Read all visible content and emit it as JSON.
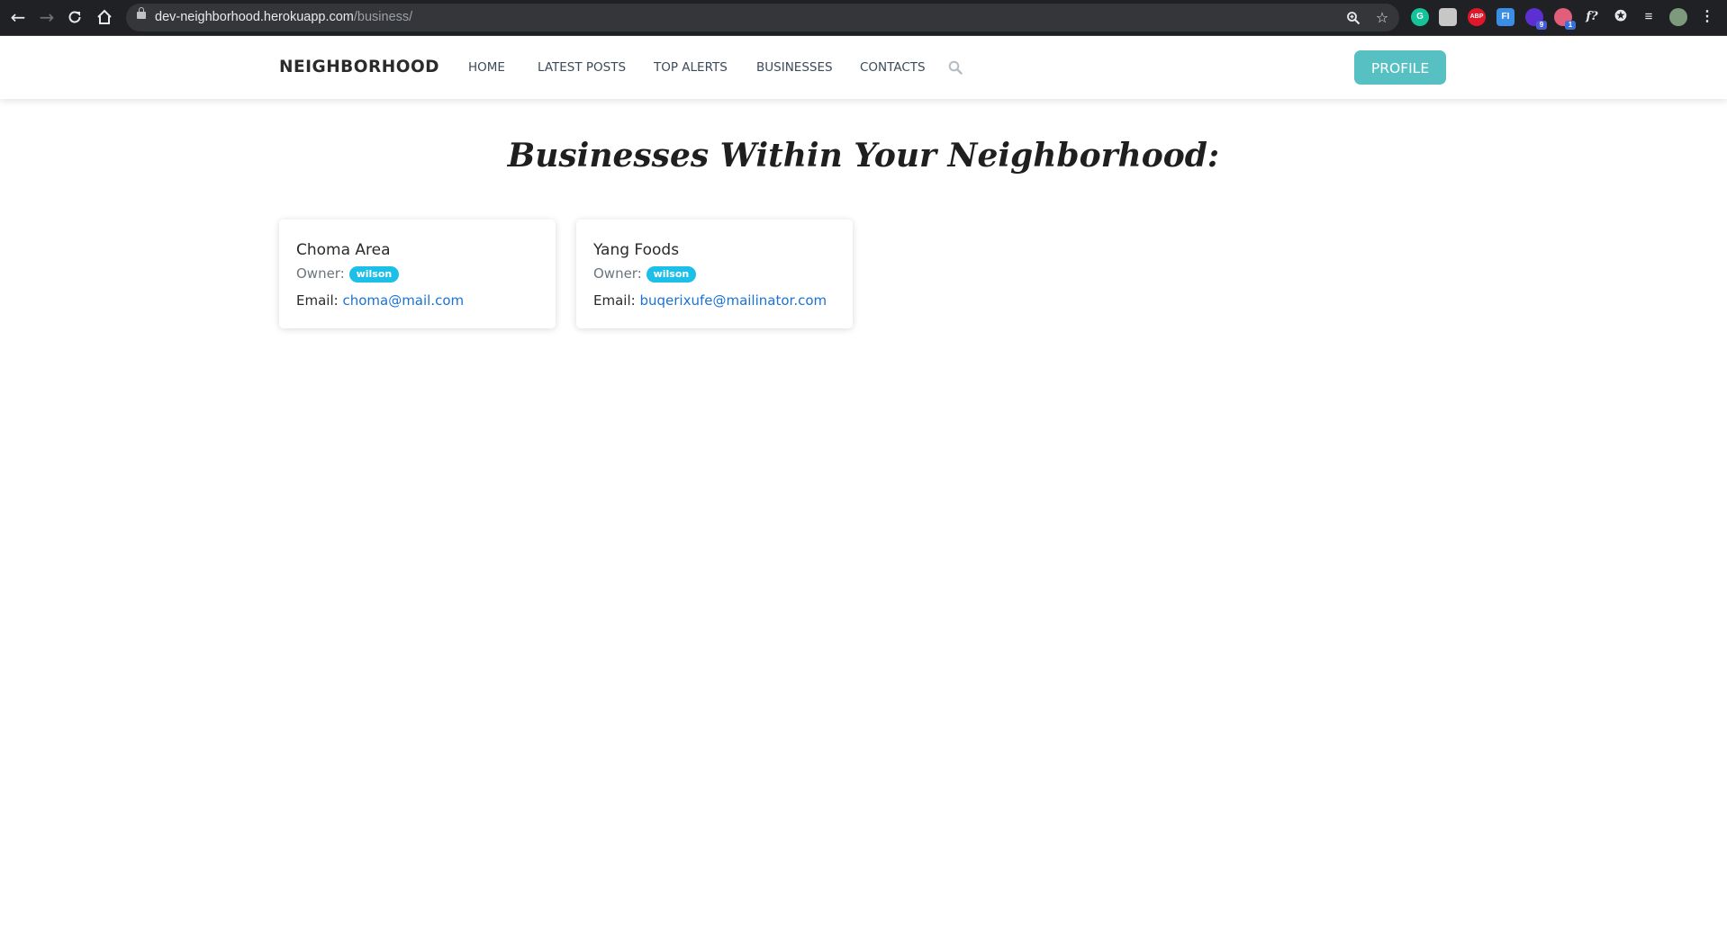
{
  "browser": {
    "url_host": "dev-neighborhood.herokuapp.com",
    "url_path": "/business/",
    "extensions": [
      {
        "name": "grammarly-icon",
        "label": "G",
        "color": "#15c39a"
      },
      {
        "name": "extension-gray-icon",
        "label": "",
        "color": "#c7c7c7"
      },
      {
        "name": "adblock-icon",
        "label": "ABP",
        "color": "#e0162b"
      },
      {
        "name": "fi-extension-icon",
        "label": "FI",
        "color": "#3a8ee6"
      },
      {
        "name": "purple-extension-icon",
        "label": "",
        "color": "#5b2fd1",
        "badge": "9"
      },
      {
        "name": "redux-extension-icon",
        "label": "",
        "color": "#e35e7a",
        "badge": "1"
      },
      {
        "name": "font-extension-icon",
        "label": "f?",
        "color": "#202124"
      }
    ]
  },
  "navbar": {
    "brand": "NEIGHBORHOOD",
    "links": [
      "HOME",
      "LATEST POSTS",
      "TOP ALERTS",
      "BUSINESSES",
      "CONTACTS"
    ],
    "profile_label": "PROFILE"
  },
  "page": {
    "title": "Businesses Within Your Neighborhood:"
  },
  "businesses": [
    {
      "name": "Choma Area",
      "owner_label": "Owner:",
      "owner": "wilson",
      "email_label": "Email:",
      "email": "choma@mail.com"
    },
    {
      "name": "Yang Foods",
      "owner_label": "Owner:",
      "owner": "wilson",
      "email_label": "Email:",
      "email": "buqerixufe@mailinator.com"
    }
  ]
}
